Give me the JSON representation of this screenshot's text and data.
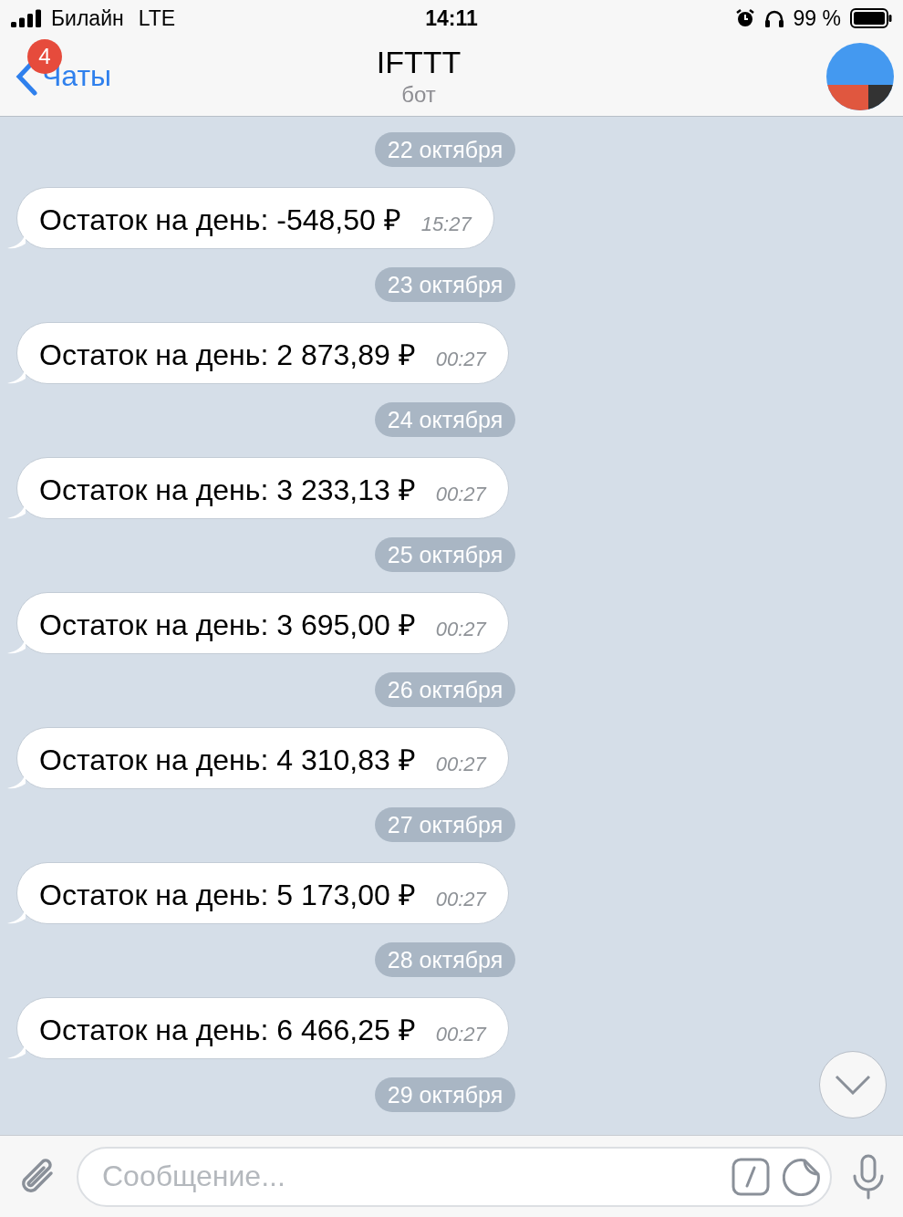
{
  "status_bar": {
    "carrier": "Билайн",
    "network": "LTE",
    "time": "14:11",
    "battery": "99 %"
  },
  "header": {
    "back_label": "Чаты",
    "unread_badge": "4",
    "title": "IFTTT",
    "subtitle": "бот"
  },
  "messages": [
    {
      "date": "22 октября",
      "text": "Остаток на день: -548,50 ₽",
      "time": "15:27"
    },
    {
      "date": "23 октября",
      "text": "Остаток на день: 2 873,89 ₽",
      "time": "00:27"
    },
    {
      "date": "24 октября",
      "text": "Остаток на день: 3 233,13 ₽",
      "time": "00:27"
    },
    {
      "date": "25 октября",
      "text": "Остаток на день: 3 695,00 ₽",
      "time": "00:27"
    },
    {
      "date": "26 октября",
      "text": "Остаток на день: 4 310,83 ₽",
      "time": "00:27"
    },
    {
      "date": "27 октября",
      "text": "Остаток на день: 5 173,00 ₽",
      "time": "00:27"
    },
    {
      "date": "28 октября",
      "text": "Остаток на день: 6 466,25 ₽",
      "time": "00:27"
    }
  ],
  "last_date": "29 октября",
  "composer": {
    "placeholder": "Сообщение..."
  }
}
